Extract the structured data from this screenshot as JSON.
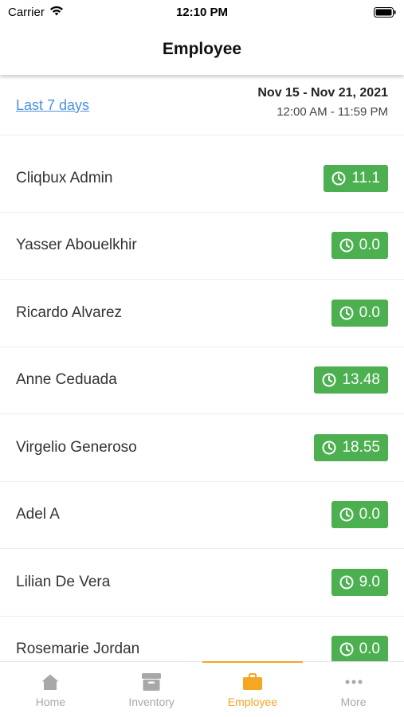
{
  "status_bar": {
    "carrier": "Carrier",
    "time": "12:10 PM"
  },
  "header": {
    "title": "Employee"
  },
  "range": {
    "link_label": "Last 7 days",
    "date_range": "Nov 15 - Nov 21, 2021",
    "time_range": "12:00 AM - 11:59 PM"
  },
  "employees": [
    {
      "name": "Cliqbux Admin",
      "hours": "11.1"
    },
    {
      "name": "Yasser Abouelkhir",
      "hours": "0.0"
    },
    {
      "name": "Ricardo Alvarez",
      "hours": "0.0"
    },
    {
      "name": "Anne Ceduada",
      "hours": "13.48"
    },
    {
      "name": "Virgelio Generoso",
      "hours": "18.55"
    },
    {
      "name": "Adel A",
      "hours": "0.0"
    },
    {
      "name": "Lilian De Vera",
      "hours": "9.0"
    },
    {
      "name": "Rosemarie Jordan",
      "hours": "0.0"
    }
  ],
  "tabs": [
    {
      "label": "Home",
      "icon": "home-icon"
    },
    {
      "label": "Inventory",
      "icon": "inventory-box-icon"
    },
    {
      "label": "Employee",
      "icon": "briefcase-icon"
    },
    {
      "label": "More",
      "icon": "more-dots-icon"
    }
  ],
  "colors": {
    "accent": "#f5a623",
    "badge_green": "#4caf50",
    "link_blue": "#4a90e2",
    "inactive_gray": "#a8a8a8"
  }
}
